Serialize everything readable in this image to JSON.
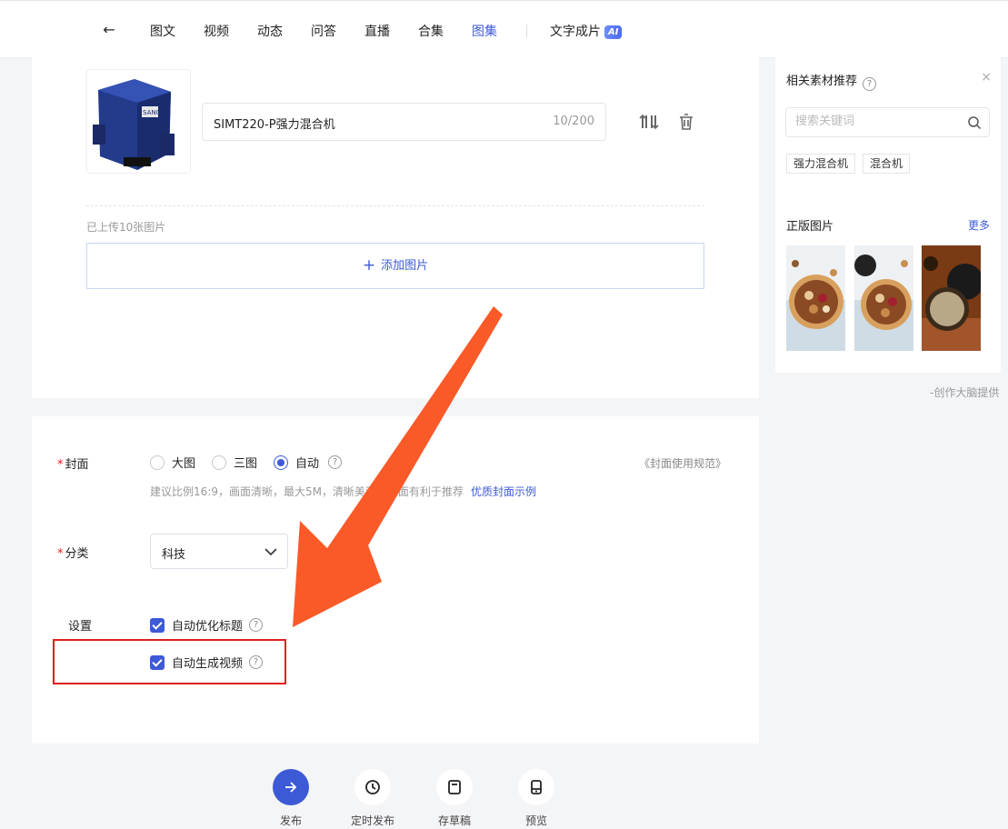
{
  "nav": {
    "back_label": "←",
    "tabs": [
      "图文",
      "视频",
      "动态",
      "问答",
      "直播",
      "合集",
      "图集"
    ],
    "active_tab": "图集",
    "ai_tab_label": "文字成片",
    "ai_badge": "AI"
  },
  "image_item": {
    "caption": "SIMT220-P强力混合机",
    "count": "10/200",
    "thumb_brand": "SANG"
  },
  "uploaded_text": "已上传10张图片",
  "add_image_label": "添加图片",
  "cover": {
    "label": "封面",
    "options": [
      "大图",
      "三图",
      "自动"
    ],
    "selected": "自动",
    "hint": "建议比例16:9，画面清晰，最大5M，清晰美观的封面有利于推荐",
    "hint_link": "优质封面示例",
    "spec_link": "《封面使用规范》"
  },
  "category": {
    "label": "分类",
    "value": "科技"
  },
  "settings": {
    "label": "设置",
    "auto_title": "自动优化标题",
    "auto_video": "自动生成视频"
  },
  "sidebar": {
    "title": "相关素材推荐",
    "close": "×",
    "search_placeholder": "搜索关键词",
    "tags": [
      "强力混合机",
      "混合机"
    ],
    "licensed_title": "正版图片",
    "more": "更多",
    "credit": "-创作大脑提供"
  },
  "actions": [
    {
      "label": "发布",
      "icon": "arrow-right-icon"
    },
    {
      "label": "定时发布",
      "icon": "clock-icon"
    },
    {
      "label": "存草稿",
      "icon": "draft-icon"
    },
    {
      "label": "预览",
      "icon": "preview-icon"
    }
  ],
  "colors": {
    "accent": "#3c5ad6",
    "annotation_arrow": "#fa5a28",
    "highlight_box": "#e02020"
  }
}
